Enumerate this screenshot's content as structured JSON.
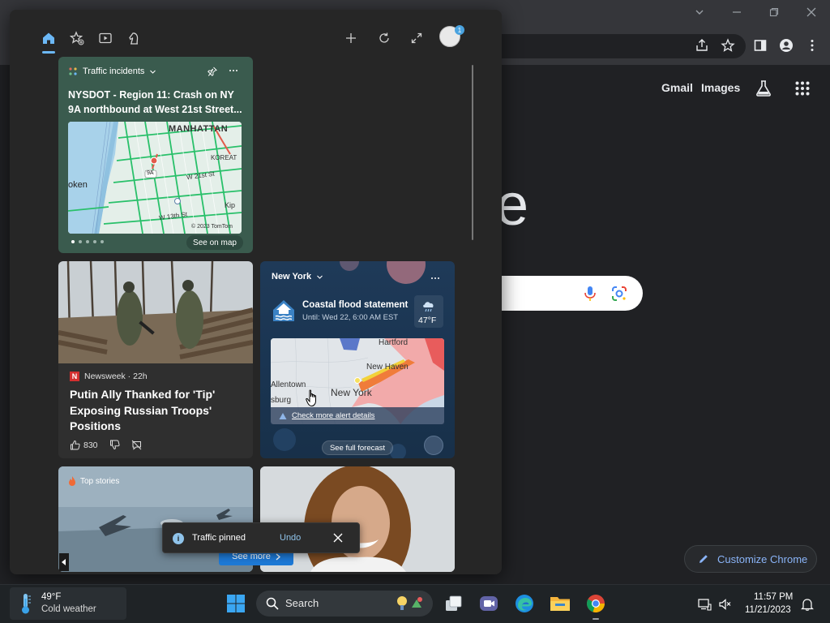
{
  "browser": {
    "links": {
      "gmail": "Gmail",
      "images": "Images"
    },
    "google_letter": "e",
    "customize_label": "Customize Chrome"
  },
  "widgets": {
    "profile_badge": "1",
    "traffic": {
      "header": "Traffic incidents",
      "title": "NYSDOT - Region 11: Crash on NY 9A northbound at West 21st Street...",
      "map_labels": [
        "MANHATTAN",
        "KOREAT",
        "oken",
        "9A",
        "W 21st St",
        "W 13th St",
        "Kip"
      ],
      "map_copyright": "© 2023 TomTom",
      "see_on_map": "See on map"
    },
    "news": {
      "source": "Newsweek · 22h",
      "source_logo": "N",
      "title": "Putin Ally Thanked for 'Tip' Exposing Russian Troops' Positions",
      "likes": "830"
    },
    "weather": {
      "city": "New York",
      "alert_title": "Coastal flood statement",
      "alert_sub": "Until: Wed 22, 6:00 AM EST",
      "temperature": "47°F",
      "map_labels": [
        "Hartford",
        "New Haven",
        "Allentown",
        "New York",
        "sburg"
      ],
      "alert_link": "Check more alert details",
      "full_forecast": "See full forecast"
    },
    "top_stories": {
      "label": "Top stories"
    },
    "toast": {
      "text": "Traffic pinned",
      "undo": "Undo"
    },
    "see_more": "See more"
  },
  "taskbar": {
    "weather_temp": "49°F",
    "weather_desc": "Cold weather",
    "search_label": "Search",
    "time": "11:57 PM",
    "date": "11/21/2023"
  }
}
